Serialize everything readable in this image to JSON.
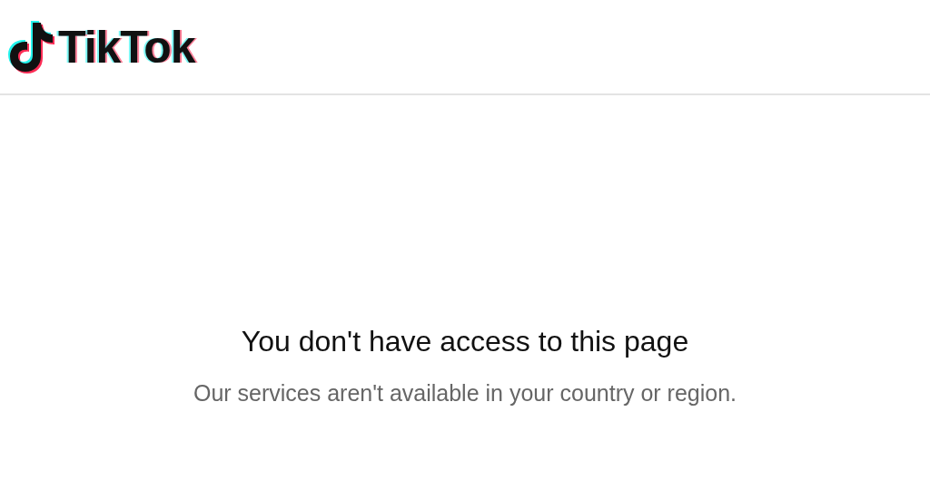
{
  "header": {
    "logo_text": "TikTok"
  },
  "message": {
    "title": "You don't have access to this page",
    "body": "Our services aren't available in your country or region."
  }
}
